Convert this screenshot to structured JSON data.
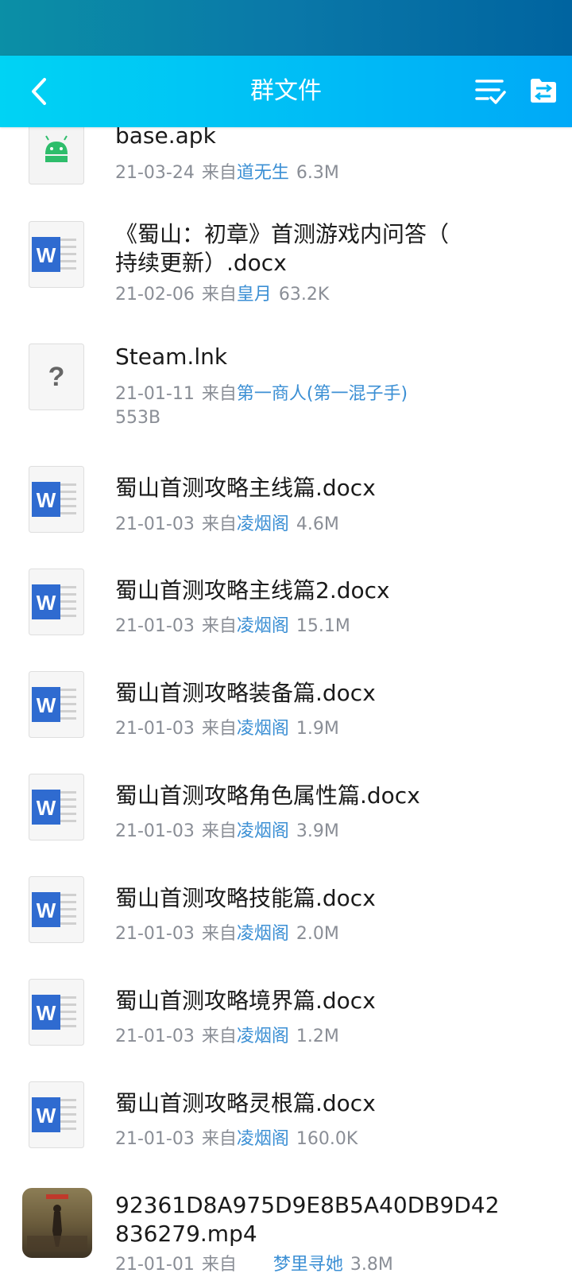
{
  "header": {
    "title": "群文件",
    "back_icon": "back-arrow-icon",
    "sort_icon": "sort-list-icon",
    "folder_icon": "folder-icon"
  },
  "colors": {
    "accent": "#00c3f5",
    "sender": "#3b8fd4",
    "word": "#2f6bd0",
    "android": "#2ebd6b"
  },
  "files": [
    {
      "name": "base.apk",
      "date": "21-03-24",
      "from_label": "来自",
      "sender": "道无生",
      "size": "6.3M",
      "icon": "android-icon"
    },
    {
      "name": "《蜀山：初章》首测游戏内问答（持续更新）.docx",
      "name_l1": "《蜀山：初章》首测游戏内问答（",
      "name_l2": "持续更新）.docx",
      "date": "21-02-06",
      "from_label": "来自",
      "sender": "皇月",
      "size": "63.2K",
      "icon": "word-icon"
    },
    {
      "name": "Steam.lnk",
      "date": "21-01-11",
      "from_label": "来自",
      "sender": "第一商人(第一混子手)",
      "size": "553B",
      "icon": "unknown-file-icon"
    },
    {
      "name": "蜀山首测攻略主线篇.docx",
      "date": "21-01-03",
      "from_label": "来自",
      "sender": "凌烟阁",
      "size": "4.6M",
      "icon": "word-icon"
    },
    {
      "name": "蜀山首测攻略主线篇2.docx",
      "date": "21-01-03",
      "from_label": "来自",
      "sender": "凌烟阁",
      "size": "15.1M",
      "icon": "word-icon"
    },
    {
      "name": "蜀山首测攻略装备篇.docx",
      "date": "21-01-03",
      "from_label": "来自",
      "sender": "凌烟阁",
      "size": "1.9M",
      "icon": "word-icon"
    },
    {
      "name": "蜀山首测攻略角色属性篇.docx",
      "date": "21-01-03",
      "from_label": "来自",
      "sender": "凌烟阁",
      "size": "3.9M",
      "icon": "word-icon"
    },
    {
      "name": "蜀山首测攻略技能篇.docx",
      "date": "21-01-03",
      "from_label": "来自",
      "sender": "凌烟阁",
      "size": "2.0M",
      "icon": "word-icon"
    },
    {
      "name": "蜀山首测攻略境界篇.docx",
      "date": "21-01-03",
      "from_label": "来自",
      "sender": "凌烟阁",
      "size": "1.2M",
      "icon": "word-icon"
    },
    {
      "name": "蜀山首测攻略灵根篇.docx",
      "date": "21-01-03",
      "from_label": "来自",
      "sender": "凌烟阁",
      "size": "160.0K",
      "icon": "word-icon"
    },
    {
      "name": "92361D8A975D9E8B5A40DB9D42836279.mp4",
      "name_l1": "92361D8A975D9E8B5A40DB9D42",
      "name_l2": "836279.mp4",
      "date": "21-01-01",
      "from_label": "来自",
      "sender": "梦里寻她",
      "size": "3.8M",
      "icon": "video-thumbnail-icon"
    }
  ]
}
